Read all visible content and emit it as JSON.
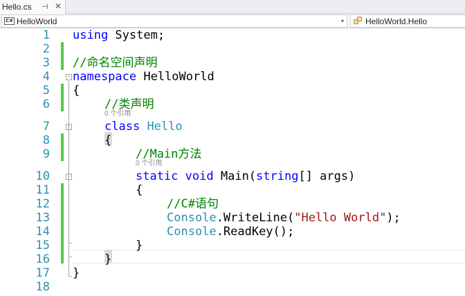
{
  "tab": {
    "title": "Hello.cs",
    "pin_glyph": "⊣",
    "close_glyph": "✕"
  },
  "navbar": {
    "project": "HelloWorld",
    "member": "HelloWorld.Hello",
    "cs_badge": "C#",
    "dropdown_glyph": "▾"
  },
  "lines": [
    {
      "num": "1",
      "tokens": [
        [
          "kw",
          "using"
        ],
        [
          "pl",
          " System;"
        ]
      ]
    },
    {
      "num": "2",
      "tokens": []
    },
    {
      "num": "3",
      "tokens": [
        [
          "cm",
          "//命名空间声明"
        ]
      ]
    },
    {
      "num": "4",
      "tokens": [
        [
          "kw",
          "namespace"
        ],
        [
          "pl",
          " HelloWorld"
        ]
      ]
    },
    {
      "num": "5",
      "tokens": [
        [
          "pl",
          "{"
        ]
      ]
    },
    {
      "num": "6",
      "tokens": [
        [
          "cm",
          "//类声明"
        ]
      ]
    },
    {
      "num": "7",
      "tokens": [
        [
          "kw",
          "class"
        ],
        [
          "pl",
          " "
        ],
        [
          "ty",
          "Hello"
        ]
      ]
    },
    {
      "num": "8",
      "tokens": [
        [
          "pl",
          "{"
        ]
      ]
    },
    {
      "num": "9",
      "tokens": [
        [
          "cm",
          "//Main方法"
        ]
      ]
    },
    {
      "num": "10",
      "tokens": [
        [
          "kw",
          "static"
        ],
        [
          "pl",
          " "
        ],
        [
          "kw",
          "void"
        ],
        [
          "pl",
          " Main("
        ],
        [
          "kw",
          "string"
        ],
        [
          "pl",
          "[] args)"
        ]
      ]
    },
    {
      "num": "11",
      "tokens": [
        [
          "pl",
          "{"
        ]
      ]
    },
    {
      "num": "12",
      "tokens": [
        [
          "cm",
          "//C#语句"
        ]
      ]
    },
    {
      "num": "13",
      "tokens": [
        [
          "ty",
          "Console"
        ],
        [
          "pl",
          ".WriteLine("
        ],
        [
          "st",
          "\"Hello World\""
        ],
        [
          "pl",
          ");"
        ]
      ]
    },
    {
      "num": "14",
      "tokens": [
        [
          "ty",
          "Console"
        ],
        [
          "pl",
          ".ReadKey();"
        ]
      ]
    },
    {
      "num": "15",
      "tokens": [
        [
          "pl",
          "}"
        ]
      ]
    },
    {
      "num": "16",
      "tokens": [
        [
          "pl",
          "}"
        ]
      ]
    },
    {
      "num": "17",
      "tokens": [
        [
          "pl",
          "}"
        ]
      ]
    },
    {
      "num": "18",
      "tokens": []
    }
  ],
  "codelens": {
    "class": "0 个引用",
    "main": "0 个引用"
  },
  "colors": {
    "keyword": "#0000ff",
    "type": "#2b91af",
    "comment": "#008000",
    "string": "#a31515",
    "change_bar": "#57c84d"
  }
}
